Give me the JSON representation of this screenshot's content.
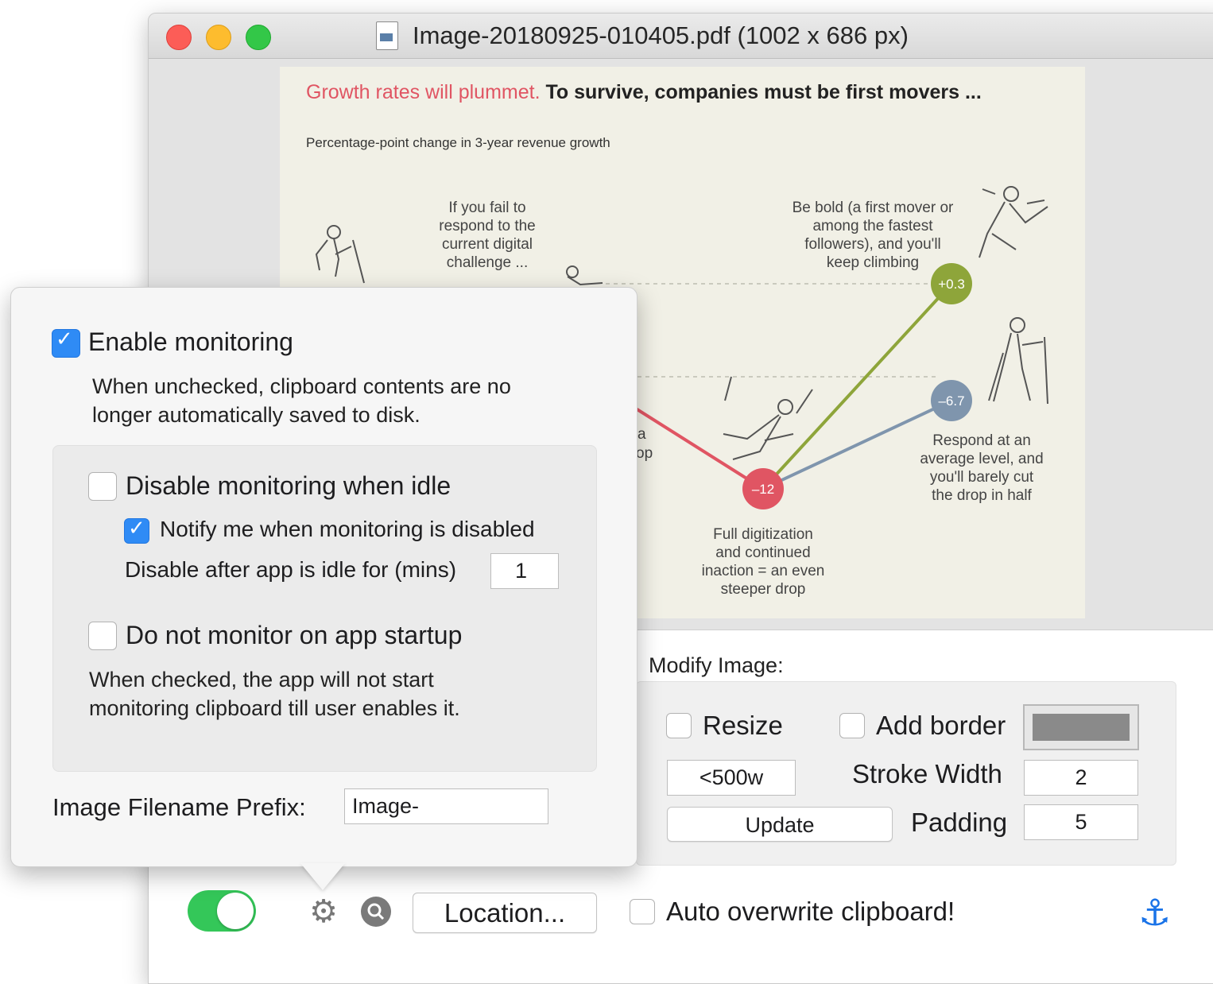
{
  "window": {
    "title": "Image-20180925-010405.pdf (1002 x 686 px)",
    "doc_icon": "pdf-document-icon"
  },
  "chart": {
    "title_red": "Growth rates will plummet.",
    "title_black": " To survive, companies must be first movers ...",
    "subtitle": "Percentage-point change in 3-year revenue growth",
    "annotation_fail": [
      "If you fail to",
      "respond to the",
      "current digital",
      "challenge ..."
    ],
    "annotation_bold": [
      "Be bold (a first mover or",
      "among the fastest",
      "followers), and you'll",
      "keep climbing"
    ],
    "annotation_full": [
      "Full digitization",
      "and continued",
      "inaction = an even",
      "steeper drop"
    ],
    "annotation_respond": [
      "Respond at an",
      "average level, and",
      "you'll barely cut",
      "the drop in half"
    ],
    "partial_a": "a",
    "partial_op": "op",
    "point_full": "–12",
    "point_bold": "+0.3",
    "point_respond": "–6.7",
    "colors": {
      "full": "#e05563",
      "bold": "#8ea53a",
      "respond": "#7f95ad"
    }
  },
  "chart_data": {
    "type": "line",
    "title": "Growth rates will plummet. To survive, companies must be first movers ...",
    "subtitle": "Percentage-point change in 3-year revenue growth",
    "series": [
      {
        "name": "Full digitization and continued inaction",
        "values": [
          -12
        ]
      },
      {
        "name": "Be bold (a first mover or among the fastest followers)",
        "values": [
          -12,
          0.3
        ]
      },
      {
        "name": "Respond at an average level",
        "values": [
          -12,
          -6.7
        ]
      }
    ],
    "data_labels": [
      "–12",
      "+0.3",
      "–6.7"
    ],
    "grid": false
  },
  "popover": {
    "enable_monitoring": {
      "label": "Enable monitoring",
      "checked": true
    },
    "enable_desc_1": "When unchecked, clipboard contents are no",
    "enable_desc_2": "longer automatically saved to disk.",
    "disable_idle": {
      "label": "Disable monitoring when idle",
      "checked": false
    },
    "notify": {
      "label": "Notify me when monitoring is disabled",
      "checked": true
    },
    "idle_label": "Disable after app is idle for (mins)",
    "idle_value": "1",
    "no_startup": {
      "label": "Do not monitor on app startup",
      "checked": false
    },
    "startup_desc_1": "When checked, the app will not start",
    "startup_desc_2": "monitoring clipboard till user enables it.",
    "prefix_label": "Image Filename Prefix:",
    "prefix_value": "Image-"
  },
  "modify": {
    "heading": "Modify Image:",
    "resize_label": "Resize",
    "resize_checked": false,
    "border_label": "Add border",
    "border_checked": false,
    "border_color": "#8a8a8a",
    "size_value": "<500w",
    "stroke_label": "Stroke Width",
    "stroke_value": "2",
    "update_label": "Update",
    "padding_label": "Padding",
    "padding_value": "5"
  },
  "bottom": {
    "monitor_toggle_on": true,
    "gear": "gear-icon",
    "search": "magnifier-icon",
    "location_label": "Location...",
    "overwrite_label": "Auto overwrite clipboard!",
    "overwrite_checked": false,
    "anchor": "anchor-icon",
    "anchor_glyph": "⚓"
  }
}
